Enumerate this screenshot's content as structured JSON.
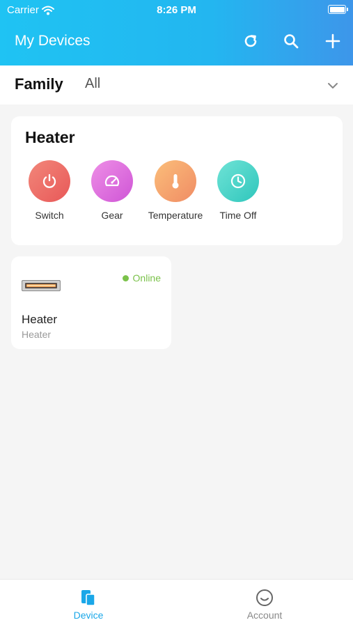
{
  "status_bar": {
    "carrier": "Carrier",
    "time": "8:26 PM"
  },
  "header": {
    "title": "My Devices",
    "icons": [
      "refresh-icon",
      "search-icon",
      "add-icon"
    ]
  },
  "tabs": {
    "active": "Family",
    "other": "All"
  },
  "scene": {
    "title": "Heater",
    "actions": [
      {
        "label": "Switch",
        "icon": "power-icon",
        "color": "#ee5e5e"
      },
      {
        "label": "Gear",
        "icon": "gauge-icon",
        "color": "#d65fd6"
      },
      {
        "label": "Temperature",
        "icon": "thermometer-icon",
        "color": "#f29d6a"
      },
      {
        "label": "Time Off",
        "icon": "clock-icon",
        "color": "#3fd0c4"
      }
    ]
  },
  "device": {
    "name": "Heater",
    "subtitle": "Heater",
    "status": "Online",
    "status_color": "#7bc24a"
  },
  "bottom_nav": {
    "items": [
      {
        "label": "Device",
        "active": true,
        "color": "#1aa7e8"
      },
      {
        "label": "Account",
        "active": false,
        "color": "#888888"
      }
    ]
  }
}
